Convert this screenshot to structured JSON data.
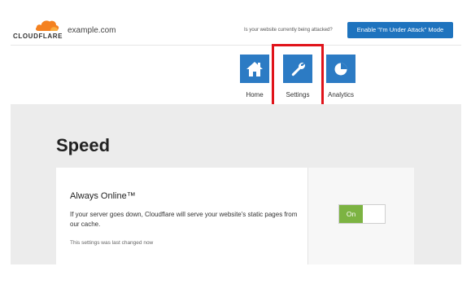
{
  "header": {
    "logo_text": "CLOUDFLARE",
    "domain": "example.com",
    "attack_question": "Is your website currently being attacked?",
    "attack_button": "Enable \"I'm Under Attack\" Mode",
    "brand_color": "#f48120"
  },
  "nav": {
    "items": [
      {
        "label": "Home",
        "icon": "home-icon"
      },
      {
        "label": "Settings",
        "icon": "wrench-icon"
      },
      {
        "label": "Analytics",
        "icon": "pie-chart-icon"
      }
    ],
    "tile_color": "#2c7bc4",
    "highlight_color": "#e0131a"
  },
  "main": {
    "page_title": "Speed",
    "setting": {
      "title": "Always Online™",
      "description": "If your server goes down, Cloudflare will serve your website's static pages from our cache.",
      "note": "This settings was last changed now",
      "toggle_label": "On",
      "toggle_color": "#7cb342"
    }
  }
}
